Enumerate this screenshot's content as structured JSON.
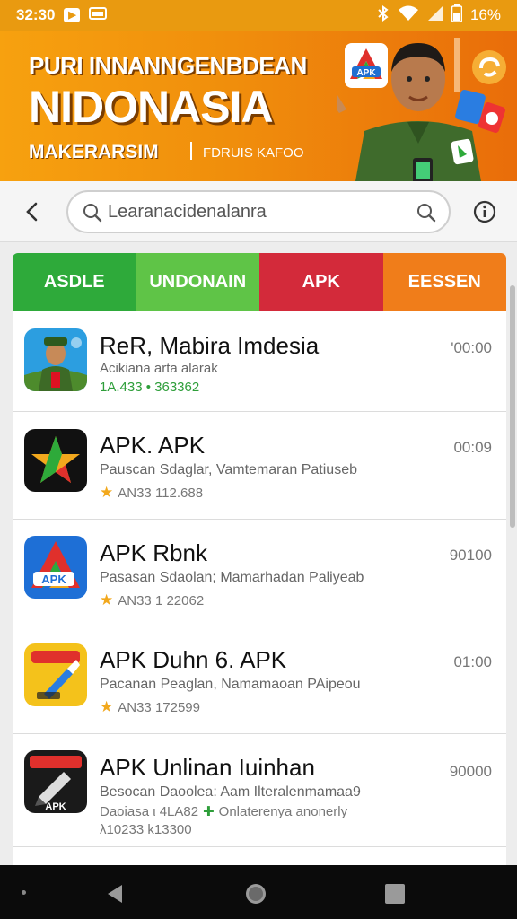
{
  "status_bar": {
    "time": "32:30",
    "battery": "16%"
  },
  "banner": {
    "line1": "PURI INNANNGENBDEAN",
    "line2": "NIDONASIA",
    "line3": "MAKERARSIM",
    "line4": "FDRUIS KAFOO",
    "logo_text": "APK"
  },
  "search": {
    "value": "Learanacidenalanra"
  },
  "tabs": [
    {
      "label": "ASDLE",
      "color": "#2eaa3a"
    },
    {
      "label": "UNDONAIN",
      "color": "#5fc447"
    },
    {
      "label": "APK",
      "color": "#d32a3a"
    },
    {
      "label": "EESSEN",
      "color": "#f07d1a"
    }
  ],
  "apps": [
    {
      "title": "ReR, Mabira Imdesia",
      "desc": "Acikiana arta alarak",
      "meta": "1A.433  •  363362",
      "time": "'00:00"
    },
    {
      "title": "APK. APK",
      "desc": "Pauscan Sdaglar, Vamtemaran Patiuseb",
      "meta": "AN33  112.688",
      "time": "00:09"
    },
    {
      "title": "APK Rbnk",
      "desc": "Pasasan Sdaolan; Mamarhadan Paliyeab",
      "meta": "AN33  1 22062",
      "time": "90100"
    },
    {
      "title": "APK Duhn 6. APK",
      "desc": "Pacanan Peaglan, Namamaoan PAipeou",
      "meta": "AN33  172599",
      "time": "01:00"
    },
    {
      "title": "APK Unlinan Iuinhan",
      "desc": "Besocan Daoolea: Aam Ilteralenmamaa9",
      "meta": "Daoiasa  ι  4LA82",
      "meta_extra": "Onlaterenya anonerly",
      "meta2": "λ10233  k13300",
      "time": "90000"
    }
  ],
  "icons": {
    "back": "chevron-left-icon",
    "search": "magnifier-icon",
    "info": "info-circle-icon",
    "star": "star-icon"
  }
}
